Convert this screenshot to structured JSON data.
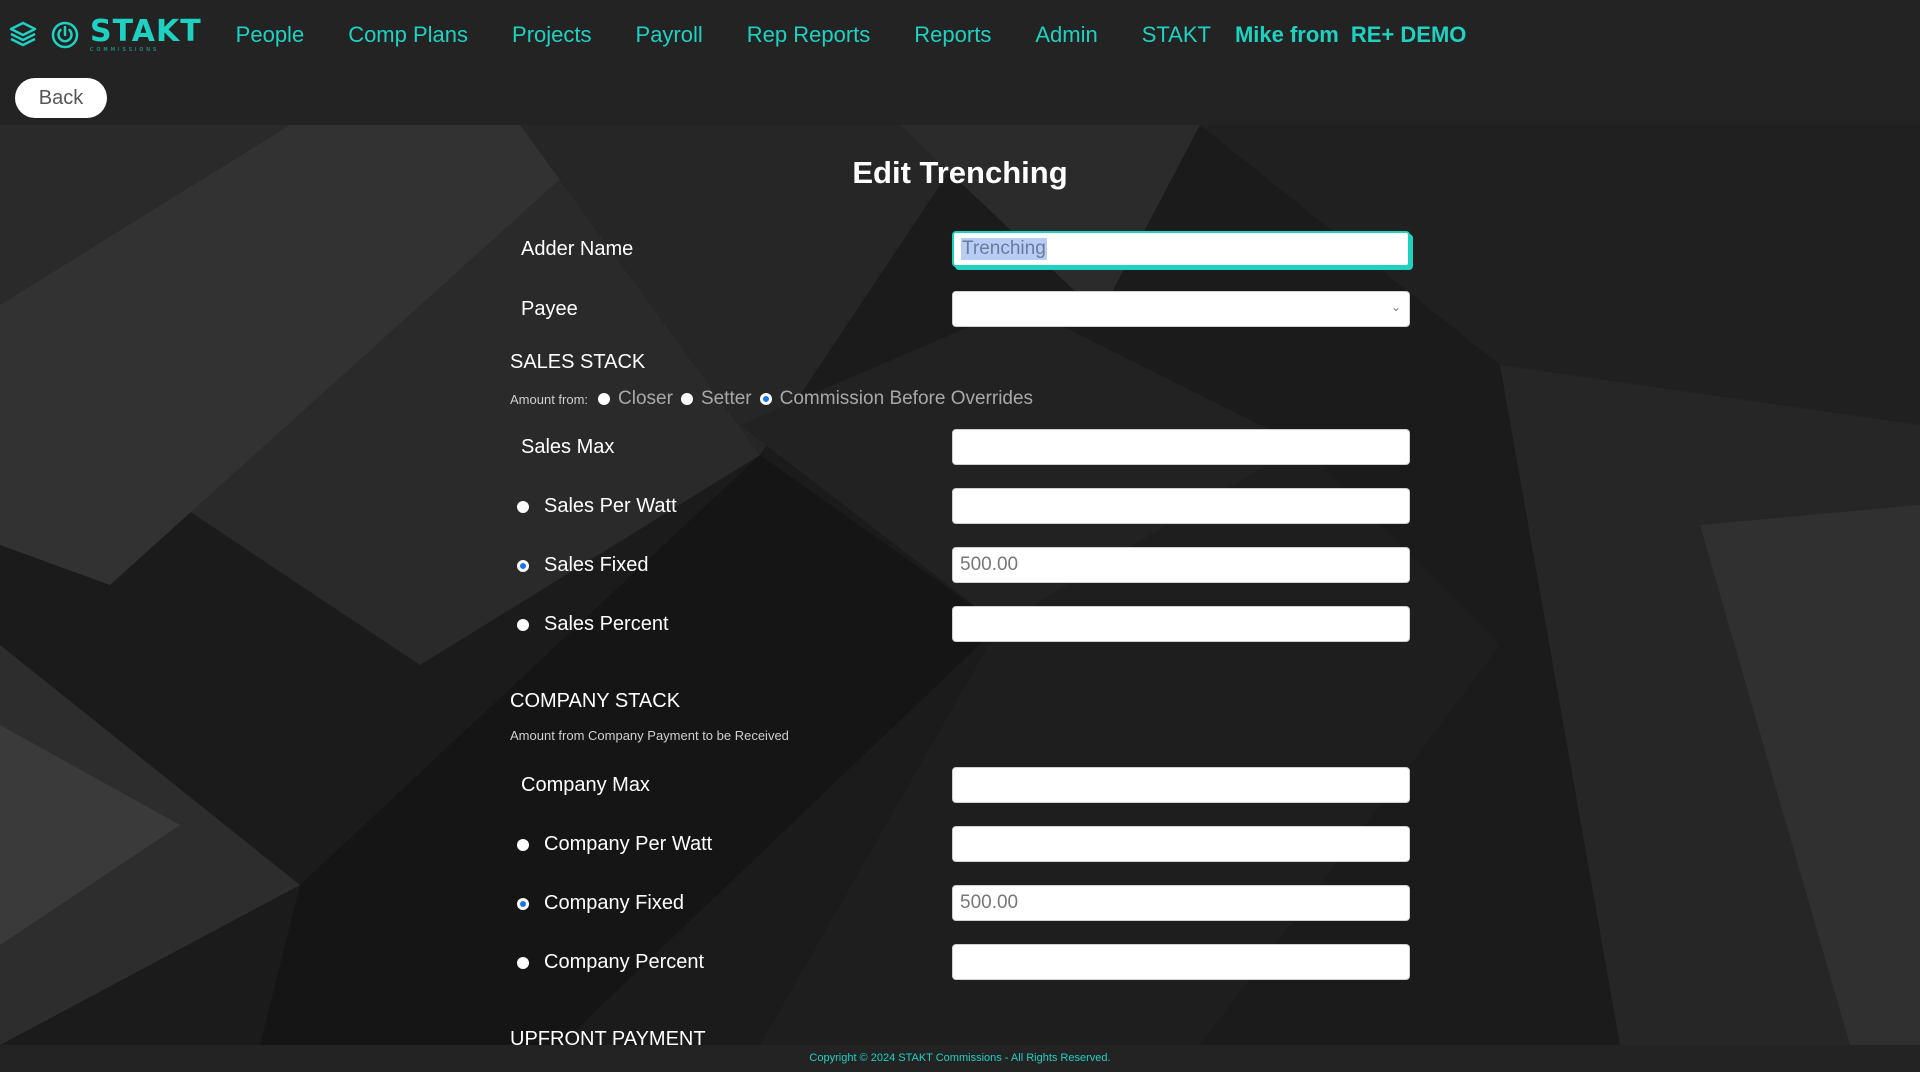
{
  "nav": {
    "brand": "STAKT",
    "brand_sub": "COMMISSIONS",
    "items": [
      "People",
      "Comp Plans",
      "Projects",
      "Payroll",
      "Rep Reports",
      "Reports",
      "Admin",
      "STAKT"
    ],
    "user_name": "Mike from",
    "org_name": "RE+ DEMO",
    "accent": "#1fd1c1"
  },
  "back_label": "Back",
  "title": "Edit Trenching",
  "adder_name": {
    "label": "Adder Name",
    "value": "Trenching"
  },
  "payee": {
    "label": "Payee",
    "value": ""
  },
  "sales_stack": {
    "heading": "SALES STACK",
    "amount_from_label": "Amount from:",
    "amount_from_options": [
      "Closer",
      "Setter",
      "Commission Before Overrides"
    ],
    "amount_from_selected": "Commission Before Overrides",
    "max_label": "Sales Max",
    "max_value": "",
    "options": [
      {
        "label": "Sales Per Watt",
        "selected": false,
        "value": ""
      },
      {
        "label": "Sales Fixed",
        "selected": true,
        "value": "500.00"
      },
      {
        "label": "Sales Percent",
        "selected": false,
        "value": ""
      }
    ]
  },
  "company_stack": {
    "heading": "COMPANY STACK",
    "note": "Amount from Company Payment to be Received",
    "max_label": "Company Max",
    "max_value": "",
    "options": [
      {
        "label": "Company Per Watt",
        "selected": false,
        "value": ""
      },
      {
        "label": "Company Fixed",
        "selected": true,
        "value": "500.00"
      },
      {
        "label": "Company Percent",
        "selected": false,
        "value": ""
      }
    ]
  },
  "upfront_heading": "UPFRONT PAYMENT",
  "footer": "Copyright © 2024 STAKT Commissions - All Rights Reserved."
}
